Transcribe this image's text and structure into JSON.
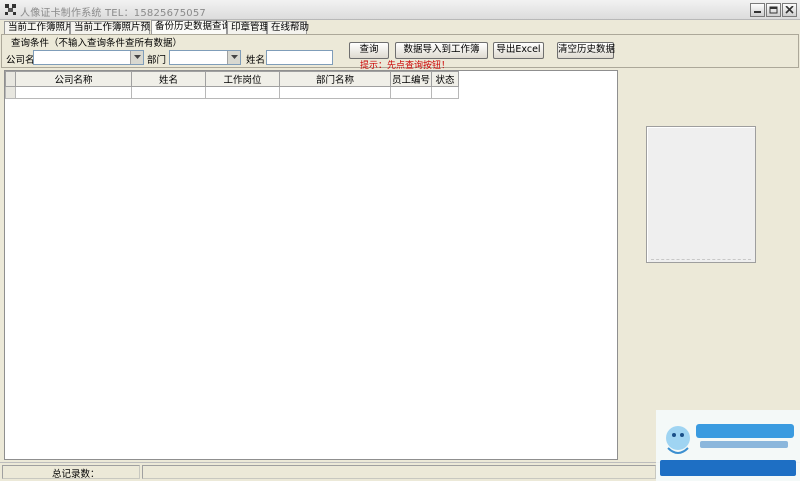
{
  "window": {
    "title": "人像证卡制作系统 TEL：15825675057",
    "controls": {
      "minimize": "minimize",
      "maximize": "maximize",
      "close": "close"
    }
  },
  "tabs": [
    {
      "label": "当前工作簿照片",
      "active": false
    },
    {
      "label": "当前工作簿照片预览",
      "active": false
    },
    {
      "label": "备份历史数据查询",
      "active": true
    },
    {
      "label": "印章管理",
      "active": false
    },
    {
      "label": "在线帮助",
      "active": false
    }
  ],
  "query_panel": {
    "caption": "查询条件（不输入查询条件查所有数据）",
    "company_label": "公司名",
    "company_value": "",
    "department_label": "部门",
    "department_value": "",
    "name_label": "姓名",
    "name_value": "",
    "buttons": {
      "query": "查询",
      "import": "数据导入到工作簿",
      "export": "导出Excel",
      "clear": "清空历史数据"
    },
    "hint": "提示：先点查询按钮！"
  },
  "grid": {
    "columns": [
      "公司名称",
      "姓名",
      "工作岗位",
      "部门名称",
      "员工编号",
      "状态"
    ],
    "rows": [
      [
        "",
        "",
        "",
        "",
        "",
        ""
      ]
    ]
  },
  "status": {
    "total_label": "总记录数："
  },
  "colors": {
    "hint": "#cc0000",
    "window_bg": "#ece9d8"
  }
}
